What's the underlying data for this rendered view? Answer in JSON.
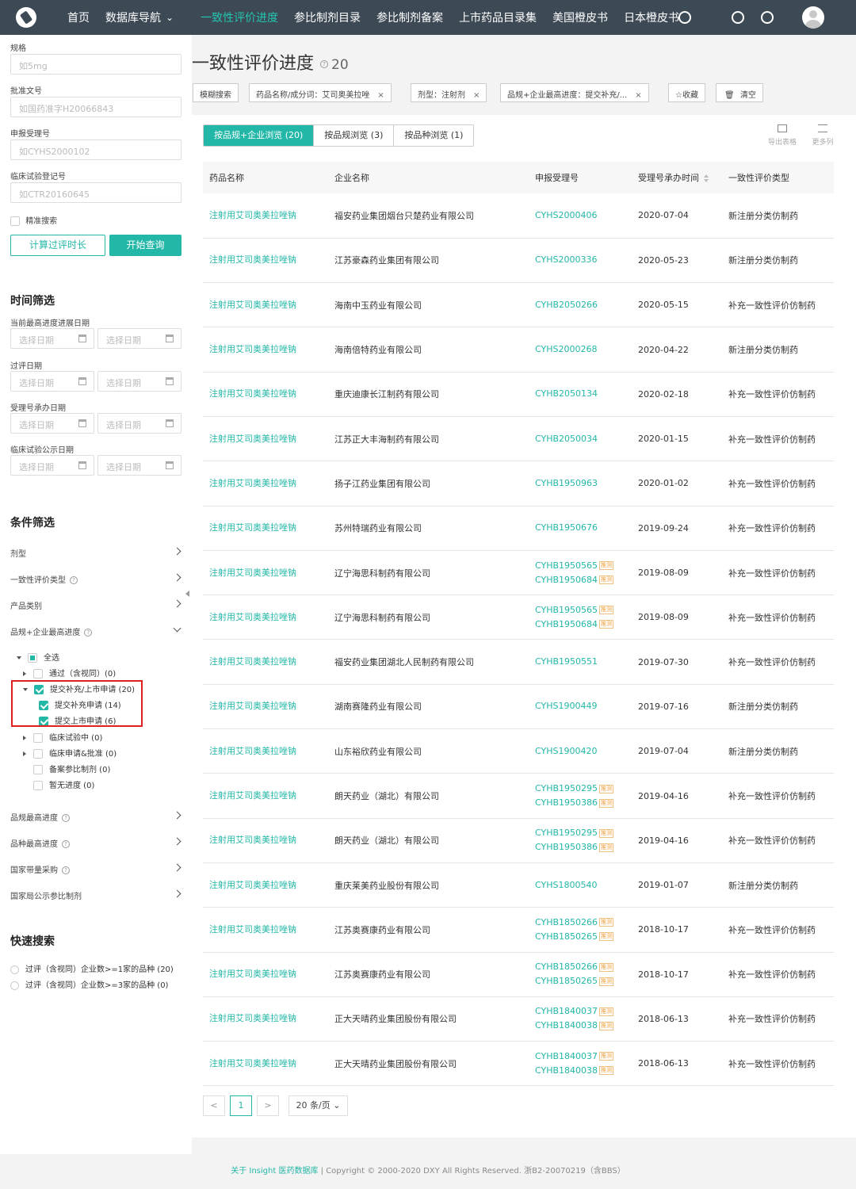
{
  "nav": {
    "items": [
      "首页",
      "数据库导航",
      "一致性评价进度",
      "参比制剂目录",
      "参比制剂备案",
      "上市药品目录集",
      "美国橙皮书",
      "日本橙皮书"
    ],
    "active_index": 2
  },
  "sidebar": {
    "spec_label": "规格",
    "spec_placeholder": "如5mg",
    "approval_label": "批准文号",
    "approval_placeholder": "如国药准字H20066843",
    "accept_label": "申报受理号",
    "accept_placeholder": "如CYHS2000102",
    "trial_label": "临床试验登记号",
    "trial_placeholder": "如CTR20160645",
    "exact_label": "精准搜索",
    "calc_button": "计算过评时长",
    "query_button": "开始查询",
    "time_title": "时间筛选",
    "date_groups": [
      "当前最高进度进展日期",
      "过评日期",
      "受理号承办日期",
      "临床试验公示日期"
    ],
    "date_placeholder": "选择日期",
    "cond_title": "条件筛选",
    "filters": [
      {
        "label": "剂型",
        "help": false
      },
      {
        "label": "一致性评价类型",
        "help": true
      },
      {
        "label": "产品类别",
        "help": false
      },
      {
        "label": "品规+企业最高进度",
        "help": true
      }
    ],
    "tree": {
      "select_all": "全选",
      "passed": "通过（含视同）(0)",
      "submitted": "提交补充/上市申请 (20)",
      "sub_supplement": "提交补充申请 (14)",
      "sub_market": "提交上市申请 (6)",
      "clinical": "临床试验中 (0)",
      "clinical_app": "临床申请&批准 (0)",
      "record": "备案参比制剂 (0)",
      "none": "暂无进度 (0)"
    },
    "filters2": [
      {
        "label": "品规最高进度",
        "help": true
      },
      {
        "label": "品种最高进度",
        "help": true
      },
      {
        "label": "国家带量采购",
        "help": true
      },
      {
        "label": "国家局公示参比制剂",
        "help": false
      }
    ],
    "quick_title": "快速搜索",
    "quick_items": [
      "过评（含视同）企业数>=1家的品种 (20)",
      "过评（含视同）企业数>=3家的品种 (0)"
    ]
  },
  "main": {
    "title": "一致性评价进度",
    "count": "20",
    "tags": {
      "fuzzy": "模糊搜索",
      "name": "药品名称/成分词：艾司奥美拉唑",
      "form": "剂型：注射剂",
      "progress": "品规+企业最高进度：提交补充/...",
      "fav": "收藏",
      "clear": "清空"
    },
    "tabs": [
      "按品规+企业浏览 (20)",
      "按品规浏览 (3)",
      "按品种浏览 (1)"
    ],
    "export_label": "导出表格",
    "more_label": "更多列",
    "columns": [
      "药品名称",
      "企业名称",
      "申报受理号",
      "受理号承办时间",
      "一致性评价类型"
    ],
    "rec_badge": "推测",
    "rows": [
      {
        "drug": "注射用艾司奥美拉唑钠",
        "company": "福安药业集团烟台只楚药业有限公司",
        "acc": [
          "CYHS2000406"
        ],
        "rec": false,
        "date": "2020-07-04",
        "type": "新注册分类仿制药"
      },
      {
        "drug": "注射用艾司奥美拉唑钠",
        "company": "江苏豪森药业集团有限公司",
        "acc": [
          "CYHS2000336"
        ],
        "rec": false,
        "date": "2020-05-23",
        "type": "新注册分类仿制药"
      },
      {
        "drug": "注射用艾司奥美拉唑钠",
        "company": "海南中玉药业有限公司",
        "acc": [
          "CYHB2050266"
        ],
        "rec": false,
        "date": "2020-05-15",
        "type": "补充一致性评价仿制药"
      },
      {
        "drug": "注射用艾司奥美拉唑钠",
        "company": "海南倍特药业有限公司",
        "acc": [
          "CYHS2000268"
        ],
        "rec": false,
        "date": "2020-04-22",
        "type": "新注册分类仿制药"
      },
      {
        "drug": "注射用艾司奥美拉唑钠",
        "company": "重庆迪康长江制药有限公司",
        "acc": [
          "CYHB2050134"
        ],
        "rec": false,
        "date": "2020-02-18",
        "type": "补充一致性评价仿制药"
      },
      {
        "drug": "注射用艾司奥美拉唑钠",
        "company": "江苏正大丰海制药有限公司",
        "acc": [
          "CYHB2050034"
        ],
        "rec": false,
        "date": "2020-01-15",
        "type": "补充一致性评价仿制药"
      },
      {
        "drug": "注射用艾司奥美拉唑钠",
        "company": "扬子江药业集团有限公司",
        "acc": [
          "CYHB1950963"
        ],
        "rec": false,
        "date": "2020-01-02",
        "type": "补充一致性评价仿制药"
      },
      {
        "drug": "注射用艾司奥美拉唑钠",
        "company": "苏州特瑞药业有限公司",
        "acc": [
          "CYHB1950676"
        ],
        "rec": false,
        "date": "2019-09-24",
        "type": "补充一致性评价仿制药"
      },
      {
        "drug": "注射用艾司奥美拉唑钠",
        "company": "辽宁海思科制药有限公司",
        "acc": [
          "CYHB1950565",
          "CYHB1950684"
        ],
        "rec": true,
        "date": "2019-08-09",
        "type": "补充一致性评价仿制药"
      },
      {
        "drug": "注射用艾司奥美拉唑钠",
        "company": "辽宁海思科制药有限公司",
        "acc": [
          "CYHB1950565",
          "CYHB1950684"
        ],
        "rec": true,
        "date": "2019-08-09",
        "type": "补充一致性评价仿制药"
      },
      {
        "drug": "注射用艾司奥美拉唑钠",
        "company": "福安药业集团湖北人民制药有限公司",
        "acc": [
          "CYHB1950551"
        ],
        "rec": false,
        "date": "2019-07-30",
        "type": "补充一致性评价仿制药"
      },
      {
        "drug": "注射用艾司奥美拉唑钠",
        "company": "湖南赛隆药业有限公司",
        "acc": [
          "CYHS1900449"
        ],
        "rec": false,
        "date": "2019-07-16",
        "type": "新注册分类仿制药"
      },
      {
        "drug": "注射用艾司奥美拉唑钠",
        "company": "山东裕欣药业有限公司",
        "acc": [
          "CYHS1900420"
        ],
        "rec": false,
        "date": "2019-07-04",
        "type": "新注册分类仿制药"
      },
      {
        "drug": "注射用艾司奥美拉唑钠",
        "company": "朗天药业（湖北）有限公司",
        "acc": [
          "CYHB1950295",
          "CYHB1950386"
        ],
        "rec": true,
        "date": "2019-04-16",
        "type": "补充一致性评价仿制药"
      },
      {
        "drug": "注射用艾司奥美拉唑钠",
        "company": "朗天药业（湖北）有限公司",
        "acc": [
          "CYHB1950295",
          "CYHB1950386"
        ],
        "rec": true,
        "date": "2019-04-16",
        "type": "补充一致性评价仿制药"
      },
      {
        "drug": "注射用艾司奥美拉唑钠",
        "company": "重庆莱美药业股份有限公司",
        "acc": [
          "CYHS1800540"
        ],
        "rec": false,
        "date": "2019-01-07",
        "type": "新注册分类仿制药"
      },
      {
        "drug": "注射用艾司奥美拉唑钠",
        "company": "江苏奥赛康药业有限公司",
        "acc": [
          "CYHB1850266",
          "CYHB1850265"
        ],
        "rec": true,
        "date": "2018-10-17",
        "type": "补充一致性评价仿制药"
      },
      {
        "drug": "注射用艾司奥美拉唑钠",
        "company": "江苏奥赛康药业有限公司",
        "acc": [
          "CYHB1850266",
          "CYHB1850265"
        ],
        "rec": true,
        "date": "2018-10-17",
        "type": "补充一致性评价仿制药"
      },
      {
        "drug": "注射用艾司奥美拉唑钠",
        "company": "正大天晴药业集团股份有限公司",
        "acc": [
          "CYHB1840037",
          "CYHB1840038"
        ],
        "rec": true,
        "date": "2018-06-13",
        "type": "补充一致性评价仿制药"
      },
      {
        "drug": "注射用艾司奥美拉唑钠",
        "company": "正大天晴药业集团股份有限公司",
        "acc": [
          "CYHB1840037",
          "CYHB1840038"
        ],
        "rec": true,
        "date": "2018-06-13",
        "type": "补充一致性评价仿制药"
      }
    ],
    "pagination": {
      "prev": "<",
      "current": "1",
      "next": ">",
      "size": "20 条/页"
    }
  },
  "footer": {
    "link": "关于 Insight 医药数据库",
    "text": " | Copyright © 2000-2020 DXY All Rights Reserved. 浙B2-20070219（含BBS）"
  },
  "colors": {
    "accent": "#23b7a7",
    "topbar": "#3d4a55",
    "highlight_box": "#e02020",
    "badge": "#f0a040"
  }
}
